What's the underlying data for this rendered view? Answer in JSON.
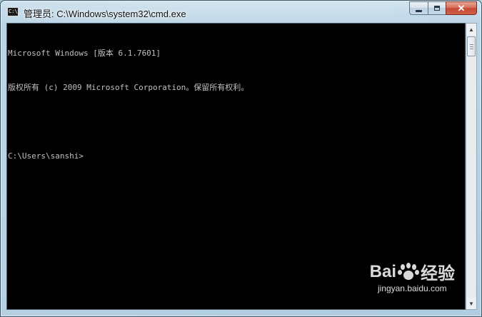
{
  "window": {
    "title": "管理员: C:\\Windows\\system32\\cmd.exe",
    "icon_text": "C:\\_"
  },
  "controls": {
    "minimize": "minimize",
    "maximize": "maximize",
    "close": "close"
  },
  "console": {
    "lines": [
      "Microsoft Windows [版本 6.1.7601]",
      "版权所有 (c) 2009 Microsoft Corporation。保留所有权利。",
      "",
      "C:\\Users\\sanshi>"
    ]
  },
  "scrollbar": {
    "up_glyph": "▲",
    "down_glyph": "▼"
  },
  "watermark": {
    "brand_left": "Bai",
    "brand_right": "经验",
    "url": "jingyan.baidu.com"
  },
  "colors": {
    "console_bg": "#000000",
    "console_text": "#c0c0c0",
    "close_button": "#c74a31"
  }
}
